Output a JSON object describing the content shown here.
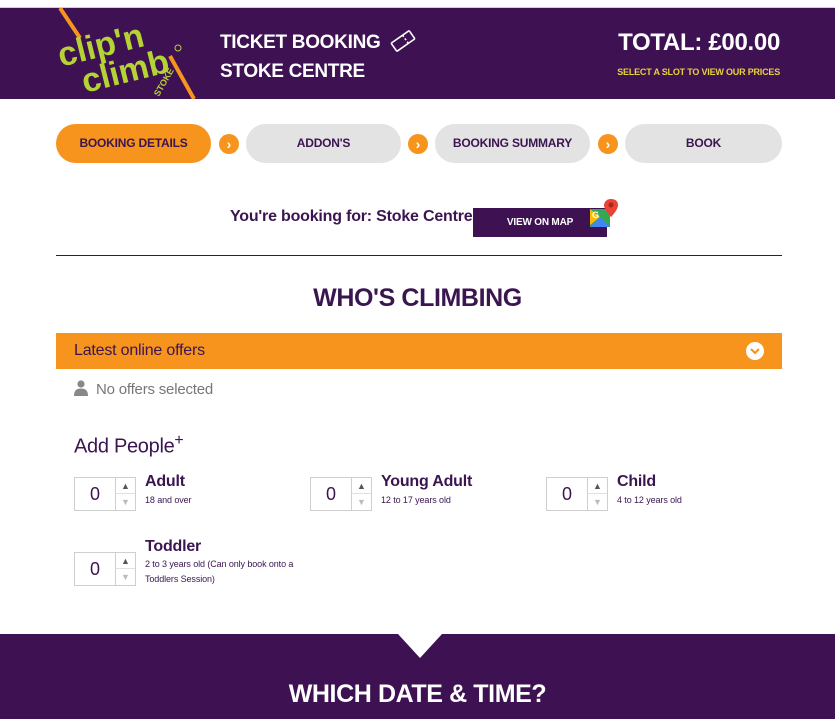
{
  "header": {
    "logo_text_top": "clip 'n",
    "logo_text_bottom": "climb",
    "logo_sub": "STOKE",
    "title_line1": "TICKET BOOKING",
    "title_line2": "STOKE CENTRE",
    "total": "TOTAL: £00.00",
    "total_hint": "SELECT A SLOT TO VIEW OUR PRICES"
  },
  "steps": [
    {
      "label": "BOOKING DETAILS",
      "active": true
    },
    {
      "label": "ADDON'S",
      "active": false
    },
    {
      "label": "BOOKING SUMMARY",
      "active": false
    },
    {
      "label": "BOOK",
      "active": false
    }
  ],
  "booking_for": {
    "text": "You're booking for: Stoke Centre",
    "map_button": "VIEW ON MAP"
  },
  "who": {
    "title": "WHO'S CLIMBING",
    "offers_label": "Latest online offers",
    "no_offers": "No offers selected",
    "add_people": "Add People",
    "add_people_sup": "+"
  },
  "people": [
    {
      "name": "Adult",
      "desc": "18 and over",
      "value": "0"
    },
    {
      "name": "Young Adult",
      "desc": "12 to 17 years old",
      "value": "0"
    },
    {
      "name": "Child",
      "desc": "4 to 12 years old",
      "value": "0"
    },
    {
      "name": "Toddler",
      "desc": "2 to 3 years old (Can only book onto a Toddlers Session)",
      "value": "0"
    }
  ],
  "footer": {
    "title": "WHICH DATE & TIME?"
  },
  "colors": {
    "brand_purple": "#3d1152",
    "accent_orange": "#f7941d",
    "logo_green": "#b5d334",
    "hint_yellow": "#e6d33a"
  },
  "icons": {
    "ticket": "ticket-icon",
    "map": "google-maps-icon",
    "person": "person-icon",
    "chevron": "chevron-down-icon",
    "step_arrow": "chevron-right-icon"
  }
}
